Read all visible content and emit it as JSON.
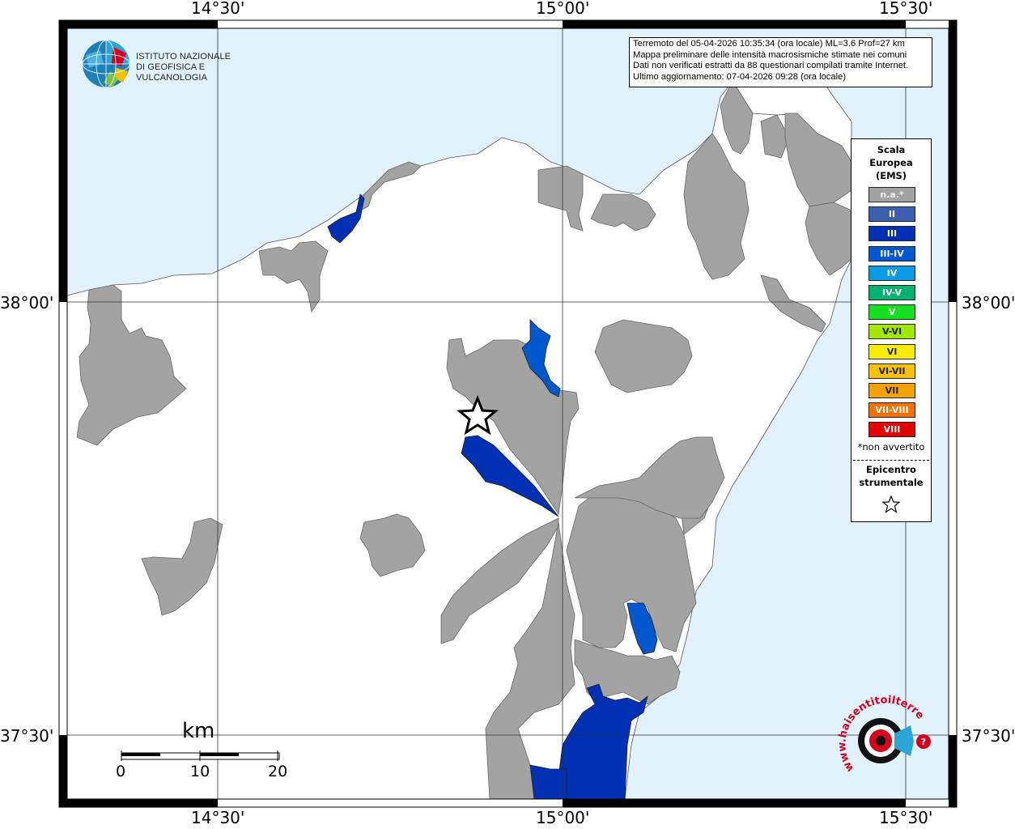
{
  "coordinates": {
    "top": [
      "14°30'",
      "15°00'",
      "15°30'"
    ],
    "bottom": [
      "14°30'",
      "15°00'",
      "15°30'"
    ],
    "left": [
      "38°00'",
      "37°30'"
    ],
    "right": [
      "38°00'",
      "37°30'"
    ]
  },
  "logo": {
    "line1": "ISTITUTO NAZIONALE",
    "line2": "DI GEOFISICA E VULCANOLOGIA"
  },
  "info": {
    "line1": "Terremoto del 05-04-2026 10:35:34 (ora locale) ML=3.6 Prof=27 km",
    "line2": "Mappa preliminare delle intensità macrosismiche stimate nei comuni",
    "line3": "Dati non verificati estratti da 88 questionari compilati tramite Internet.",
    "line4": "Ultimo aggiornamento: 07-04-2026 09:28 (ora locale)"
  },
  "legend": {
    "title1": "Scala",
    "title2": "Europea",
    "title3": "(EMS)",
    "items": [
      {
        "label": "n.a.*",
        "color": "#a3a3a3"
      },
      {
        "label": "II",
        "color": "#3d5fb0"
      },
      {
        "label": "III",
        "color": "#0030b4"
      },
      {
        "label": "III-IV",
        "color": "#0058cf"
      },
      {
        "label": "IV",
        "color": "#0a9ae6"
      },
      {
        "label": "IV-V",
        "color": "#00b26f"
      },
      {
        "label": "V",
        "color": "#17e021"
      },
      {
        "label": "V-VI",
        "color": "#a3e600"
      },
      {
        "label": "VI",
        "color": "#f5ee00"
      },
      {
        "label": "VI-VII",
        "color": "#f7c200"
      },
      {
        "label": "VII",
        "color": "#f5a200"
      },
      {
        "label": "VII-VIII",
        "color": "#f57200"
      },
      {
        "label": "VIII",
        "color": "#e50000"
      }
    ],
    "note": "*non avvertito",
    "epi1": "Epicentro",
    "epi2": "strumentale"
  },
  "scale": {
    "unit": "km",
    "labels": [
      "0",
      "10",
      "20"
    ]
  },
  "colors": {
    "sea": "#e1f2fd",
    "land": "#ffffff",
    "na": "#a3a3a3",
    "III": "#0030b4",
    "III-IV": "#0058cf"
  },
  "brand": {
    "hs_text": "www.haisentitoilterremoto.it"
  }
}
